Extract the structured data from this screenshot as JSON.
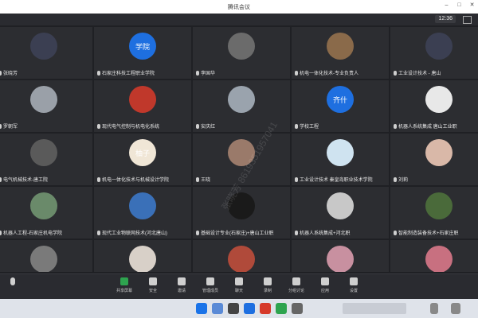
{
  "window": {
    "title": "腾讯会议"
  },
  "topbar": {
    "time": "12:36"
  },
  "tiles": [
    {
      "id": "t1",
      "name": "张晓芳",
      "avatar_text": "",
      "avatar_color": "#3b3f52"
    },
    {
      "id": "t2",
      "name": "石家庄科技工程职业学院",
      "avatar_text": "学院",
      "avatar_color": "#1e6fe0"
    },
    {
      "id": "t3",
      "name": "李国华",
      "avatar_text": "",
      "avatar_color": "#6b6b6b"
    },
    {
      "id": "t4",
      "name": "机电一体化技术-专业负责人",
      "avatar_text": "",
      "avatar_color": "#8a6a4a"
    },
    {
      "id": "t5",
      "name": "工业设计技术 - 唐山",
      "avatar_text": "",
      "avatar_color": "#3b3f52"
    },
    {
      "id": "t6",
      "name": "罗朝军",
      "avatar_text": "",
      "avatar_color": "#9aa0a8"
    },
    {
      "id": "t7",
      "name": "现代电气控制与机电化系统",
      "avatar_text": "",
      "avatar_color": "#c0382b"
    },
    {
      "id": "t8",
      "name": "安庆红",
      "avatar_text": "",
      "avatar_color": "#9aa3ad"
    },
    {
      "id": "t9",
      "name": "学校工程",
      "avatar_text": "齐什",
      "avatar_color": "#1e6fe0"
    },
    {
      "id": "t10",
      "name": "机器人系统集成 唐山工业职",
      "avatar_text": "",
      "avatar_color": "#e8e8e8"
    },
    {
      "id": "t11",
      "name": "电气机械技术-唐工院",
      "avatar_text": "",
      "avatar_color": "#5a5a5a"
    },
    {
      "id": "t12",
      "name": "机电一体化技术与机械设计学院",
      "avatar_text": "柚子",
      "avatar_color": "#f0e6d6"
    },
    {
      "id": "t13",
      "name": "王晓",
      "avatar_text": "",
      "avatar_color": "#9a7a6a"
    },
    {
      "id": "t14",
      "name": "工业设计技术 秦皇岛职业技术学院",
      "avatar_text": "",
      "avatar_color": "#cfe3f0"
    },
    {
      "id": "t15",
      "name": "刘莉",
      "avatar_text": "",
      "avatar_color": "#d9b8a8"
    },
    {
      "id": "t16",
      "name": "机器人工程-石家庄机电学院",
      "avatar_text": "",
      "avatar_color": "#6a8a6a"
    },
    {
      "id": "t17",
      "name": "现代工业物联网技术(河北唐山)",
      "avatar_text": "",
      "avatar_color": "#3a70b8"
    },
    {
      "id": "t18",
      "name": "基础设计专业(石家庄)+唐山工业职",
      "avatar_text": "",
      "avatar_color": "#1a1a1a"
    },
    {
      "id": "t19",
      "name": "机器人系统集成+河北职",
      "avatar_text": "",
      "avatar_color": "#c8c8c8"
    },
    {
      "id": "t20",
      "name": "智能制造装备技术+石家庄职",
      "avatar_text": "",
      "avatar_color": "#4a6a3a"
    },
    {
      "id": "t21",
      "name": "",
      "avatar_text": "",
      "avatar_color": "#7a7a7a"
    },
    {
      "id": "t22",
      "name": "",
      "avatar_text": "",
      "avatar_color": "#d8d0c8"
    },
    {
      "id": "t23",
      "name": "",
      "avatar_text": "",
      "avatar_color": "#b04a3a"
    },
    {
      "id": "t24",
      "name": "",
      "avatar_text": "",
      "avatar_color": "#c890a0"
    },
    {
      "id": "t25",
      "name": "",
      "avatar_text": "",
      "avatar_color": "#c87080"
    }
  ],
  "toolbar": {
    "buttons": [
      {
        "id": "b1",
        "label": "共享屏幕",
        "icon": "share-screen-icon",
        "color": "#2ea44f"
      },
      {
        "id": "b2",
        "label": "安全",
        "icon": "shield-icon",
        "color": "#cfcfcf"
      },
      {
        "id": "b3",
        "label": "邀请",
        "icon": "invite-icon",
        "color": "#cfcfcf"
      },
      {
        "id": "b4",
        "label": "管理成员",
        "icon": "members-icon",
        "color": "#cfcfcf"
      },
      {
        "id": "b5",
        "label": "聊天",
        "icon": "chat-icon",
        "color": "#cfcfcf"
      },
      {
        "id": "b6",
        "label": "录制",
        "icon": "record-icon",
        "color": "#cfcfcf"
      },
      {
        "id": "b7",
        "label": "分组讨论",
        "icon": "group-icon",
        "color": "#cfcfcf"
      },
      {
        "id": "b8",
        "label": "应用",
        "icon": "apps-icon",
        "color": "#cfcfcf"
      },
      {
        "id": "b9",
        "label": "设置",
        "icon": "gear-icon",
        "color": "#cfcfcf"
      }
    ]
  },
  "watermark": "张晓芳 8619351957041"
}
